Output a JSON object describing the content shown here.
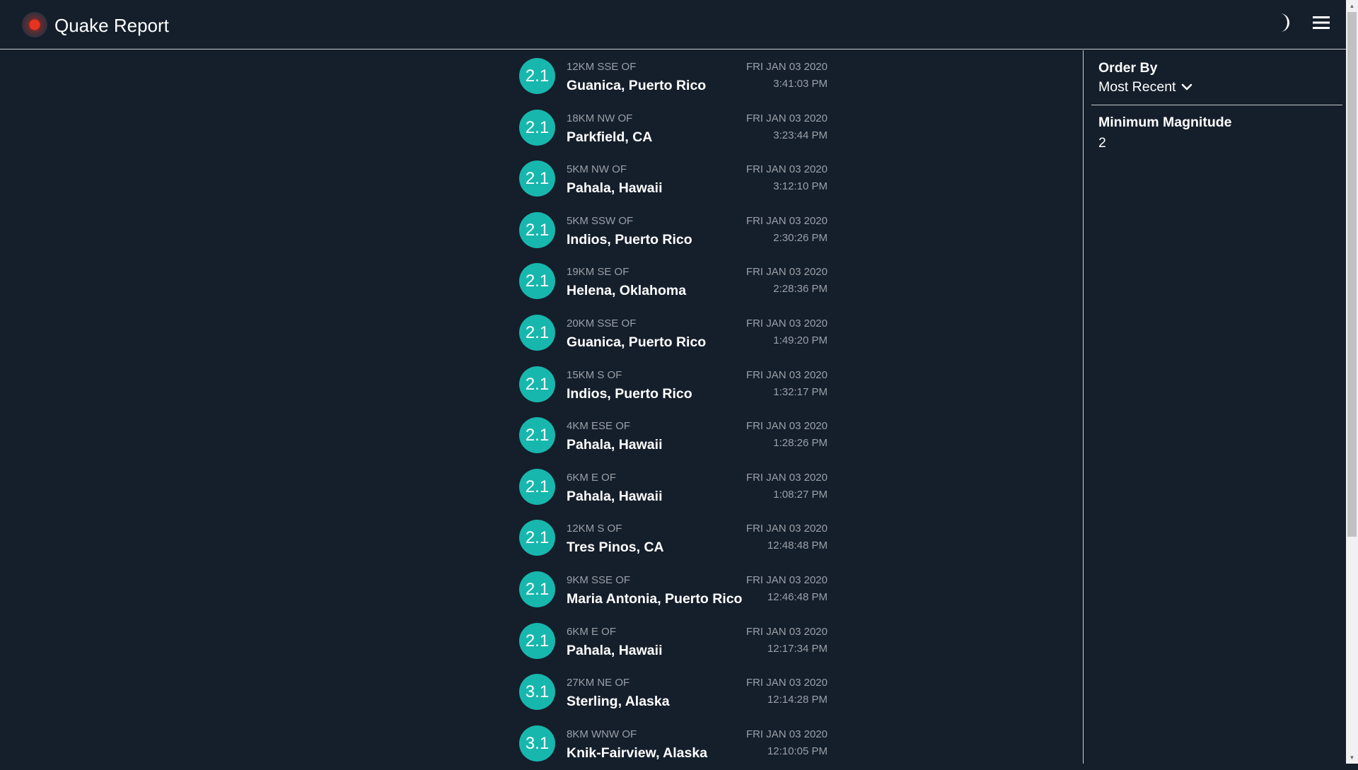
{
  "header": {
    "title": "Quake Report"
  },
  "colors": {
    "background": "#151e2b",
    "magnitude_badge": "#17b7ad",
    "logo_red": "#e5331f",
    "muted_text": "#9aa0a8"
  },
  "icons": {
    "logo": "red-dot-logo-icon",
    "theme_toggle": "moon-icon",
    "menu": "hamburger-menu-icon",
    "order_dropdown": "chevron-down-icon"
  },
  "quakes": [
    {
      "mag": "2.1",
      "offset": "12KM SSE OF",
      "place": "Guanica, Puerto Rico",
      "date": "FRI JAN 03 2020",
      "time": "3:41:03 PM"
    },
    {
      "mag": "2.1",
      "offset": "18KM NW OF",
      "place": "Parkfield, CA",
      "date": "FRI JAN 03 2020",
      "time": "3:23:44 PM"
    },
    {
      "mag": "2.1",
      "offset": "5KM NW OF",
      "place": "Pahala, Hawaii",
      "date": "FRI JAN 03 2020",
      "time": "3:12:10 PM"
    },
    {
      "mag": "2.1",
      "offset": "5KM SSW OF",
      "place": "Indios, Puerto Rico",
      "date": "FRI JAN 03 2020",
      "time": "2:30:26 PM"
    },
    {
      "mag": "2.1",
      "offset": "19KM SE OF",
      "place": "Helena, Oklahoma",
      "date": "FRI JAN 03 2020",
      "time": "2:28:36 PM"
    },
    {
      "mag": "2.1",
      "offset": "20KM SSE OF",
      "place": "Guanica, Puerto Rico",
      "date": "FRI JAN 03 2020",
      "time": "1:49:20 PM"
    },
    {
      "mag": "2.1",
      "offset": "15KM S OF",
      "place": "Indios, Puerto Rico",
      "date": "FRI JAN 03 2020",
      "time": "1:32:17 PM"
    },
    {
      "mag": "2.1",
      "offset": "4KM ESE OF",
      "place": "Pahala, Hawaii",
      "date": "FRI JAN 03 2020",
      "time": "1:28:26 PM"
    },
    {
      "mag": "2.1",
      "offset": "6KM E OF",
      "place": "Pahala, Hawaii",
      "date": "FRI JAN 03 2020",
      "time": "1:08:27 PM"
    },
    {
      "mag": "2.1",
      "offset": "12KM S OF",
      "place": "Tres Pinos, CA",
      "date": "FRI JAN 03 2020",
      "time": "12:48:48 PM"
    },
    {
      "mag": "2.1",
      "offset": "9KM SSE OF",
      "place": "Maria Antonia, Puerto Rico",
      "date": "FRI JAN 03 2020",
      "time": "12:46:48 PM"
    },
    {
      "mag": "2.1",
      "offset": "6KM E OF",
      "place": "Pahala, Hawaii",
      "date": "FRI JAN 03 2020",
      "time": "12:17:34 PM"
    },
    {
      "mag": "3.1",
      "offset": "27KM NE OF",
      "place": "Sterling, Alaska",
      "date": "FRI JAN 03 2020",
      "time": "12:14:28 PM"
    },
    {
      "mag": "3.1",
      "offset": "8KM WNW OF",
      "place": "Knik-Fairview, Alaska",
      "date": "FRI JAN 03 2020",
      "time": "12:10:05 PM"
    }
  ],
  "sidebar": {
    "order_by_label": "Order By",
    "order_by_value": "Most Recent",
    "min_magnitude_label": "Minimum Magnitude",
    "min_magnitude_value": "2"
  },
  "scrollbar": {
    "up_arrow": "▲",
    "down_arrow": "▼"
  }
}
